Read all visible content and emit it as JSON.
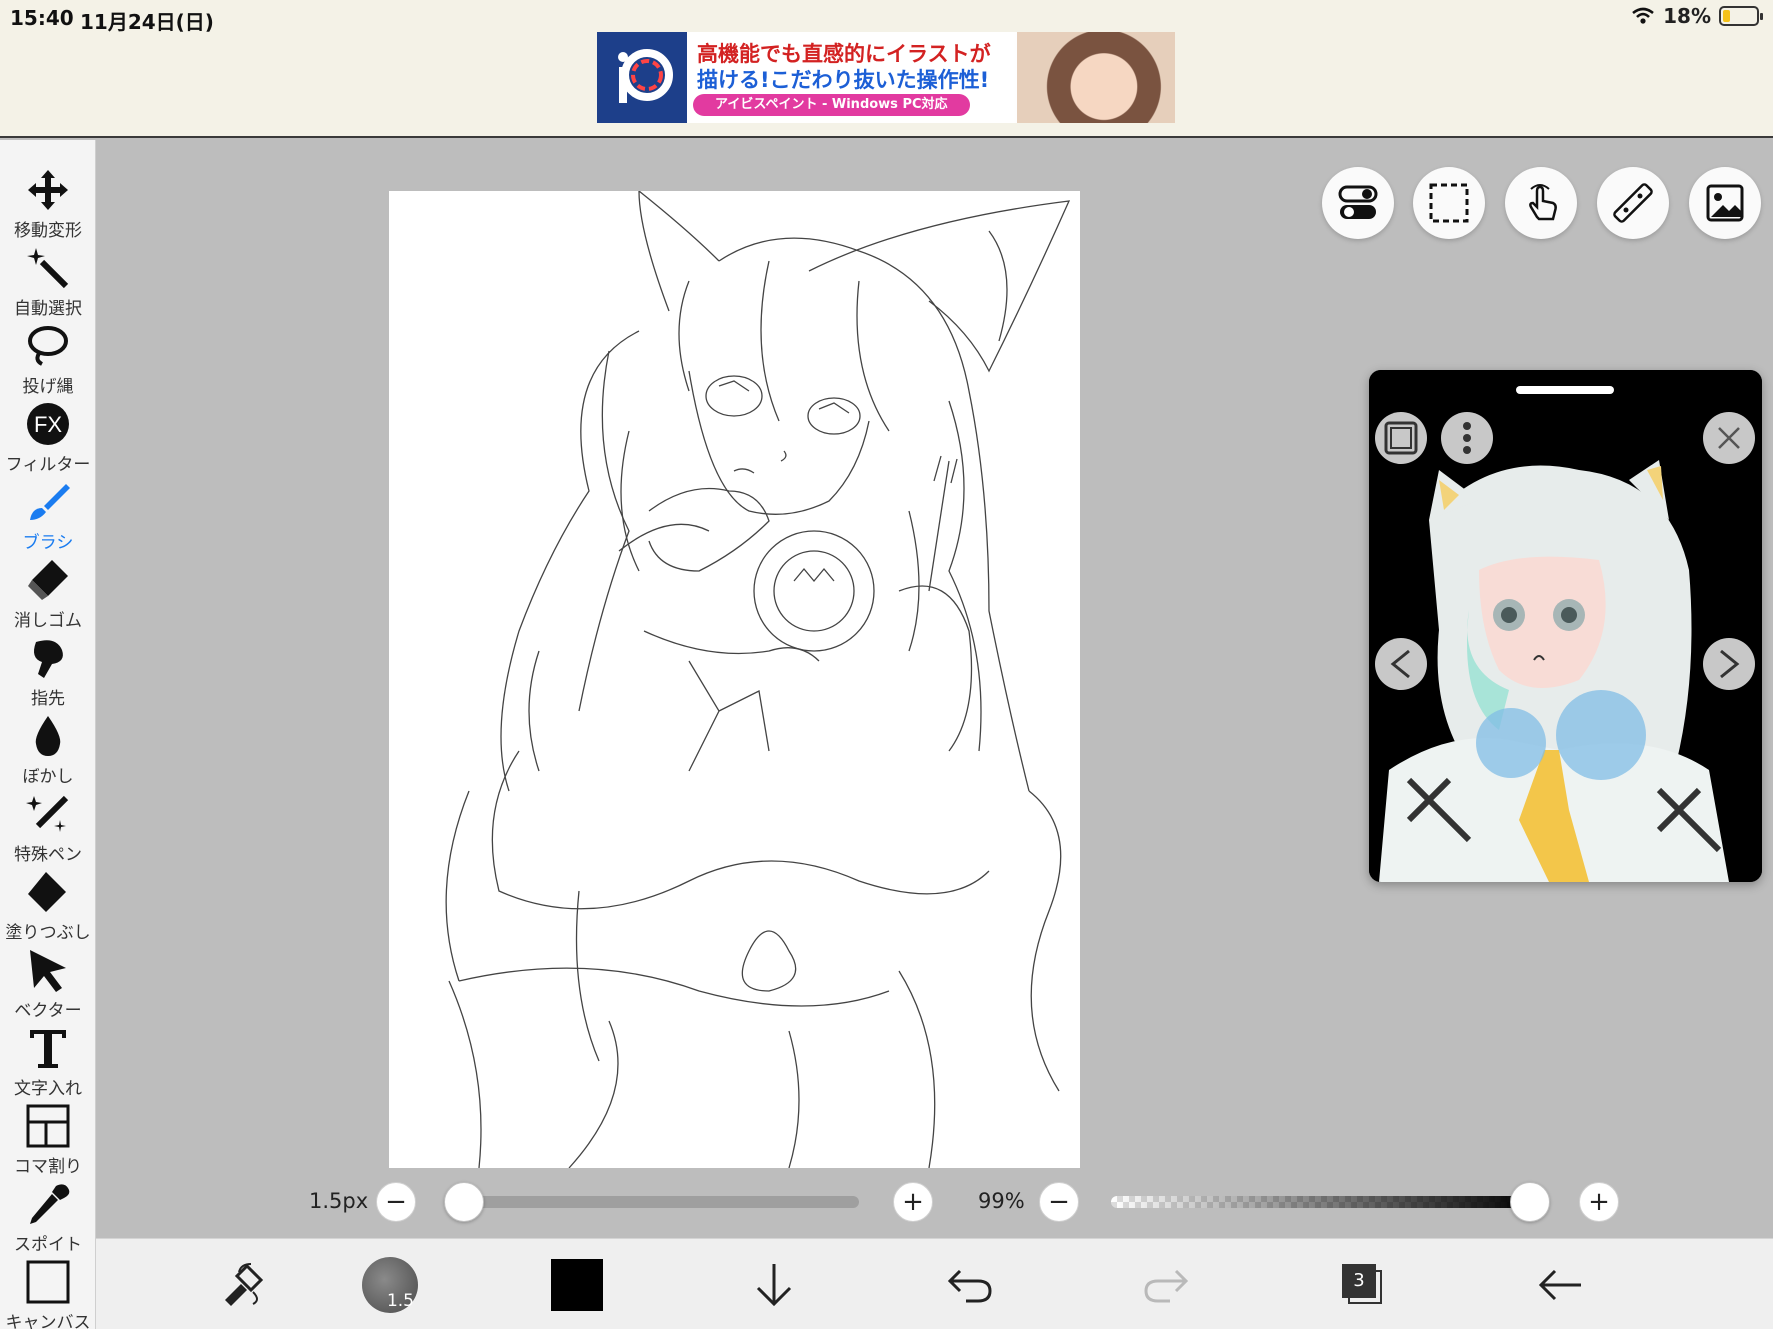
{
  "status": {
    "time": "15:40",
    "date": "11月24日(日)",
    "battery": "18%"
  },
  "ad": {
    "line1": "高機能でも直感的にイラストが",
    "line2": "描ける!こだわり抜いた操作性!",
    "pill": "アイビスペイント - Windows PC対応"
  },
  "toolbar": {
    "items": [
      {
        "label": "移動変形",
        "icon": "move-icon"
      },
      {
        "label": "自動選択",
        "icon": "magic-wand-icon"
      },
      {
        "label": "投げ縄",
        "icon": "lasso-icon"
      },
      {
        "label": "フィルター",
        "icon": "fx-icon"
      },
      {
        "label": "ブラシ",
        "icon": "brush-icon",
        "active": true
      },
      {
        "label": "消しゴム",
        "icon": "eraser-icon"
      },
      {
        "label": "指先",
        "icon": "smudge-icon"
      },
      {
        "label": "ぼかし",
        "icon": "blur-drop-icon"
      },
      {
        "label": "特殊ペン",
        "icon": "special-pen-icon"
      },
      {
        "label": "塗りつぶし",
        "icon": "fill-icon"
      },
      {
        "label": "ベクター",
        "icon": "vector-arrow-icon"
      },
      {
        "label": "文字入れ",
        "icon": "text-icon"
      },
      {
        "label": "コマ割り",
        "icon": "frame-divider-icon"
      },
      {
        "label": "スポイト",
        "icon": "eyedropper-icon"
      },
      {
        "label": "キャンバス",
        "icon": "canvas-icon"
      }
    ]
  },
  "sliders": {
    "brush_size": "1.5px",
    "brush_size_fraction": 0.0,
    "opacity": "99%",
    "opacity_fraction": 0.99
  },
  "bottombar": {
    "brush_size_badge": "1.5",
    "layer_count": "3",
    "active_color": "#000000"
  },
  "colors": {
    "accent": "#1a7cf0",
    "canvas_bg": "#bdbdbd"
  }
}
